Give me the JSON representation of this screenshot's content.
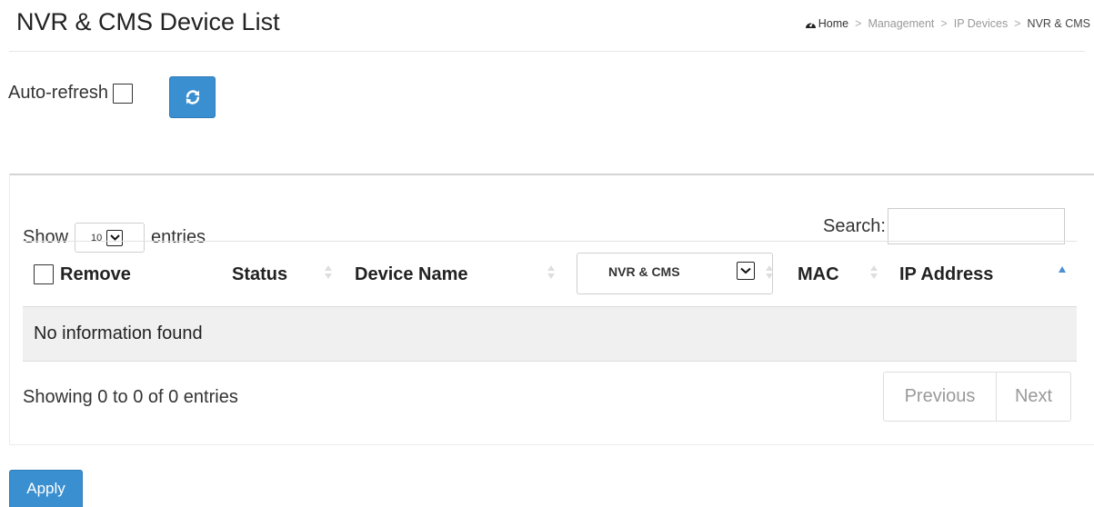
{
  "header": {
    "title": "NVR & CMS Device List",
    "breadcrumb": {
      "home": "Home",
      "separator": ">",
      "items": [
        "Management",
        "IP Devices"
      ],
      "current": "NVR & CMS"
    }
  },
  "toolbar": {
    "auto_refresh_label": "Auto-refresh",
    "auto_refresh_checked": false,
    "refresh_icon": "refresh-icon"
  },
  "table_controls": {
    "show_label": "Show",
    "length_value": "10",
    "entries_label": "entries",
    "search_label": "Search:",
    "search_value": ""
  },
  "table": {
    "columns": {
      "remove": "Remove",
      "status": "Status",
      "device_name": "Device Name",
      "type_filter": "NVR & CMS",
      "mac": "MAC",
      "ip_address": "IP Address"
    },
    "sorted_column": "IP Address",
    "sort_direction": "ascending",
    "empty_message": "No information found"
  },
  "footer": {
    "info": "Showing 0 to 0 of 0 entries",
    "previous": "Previous",
    "next": "Next",
    "apply": "Apply"
  },
  "colors": {
    "primary_button": "#3a8fd0",
    "sort_active": "#4a8fd4",
    "empty_row_bg": "#f0f0f0"
  }
}
